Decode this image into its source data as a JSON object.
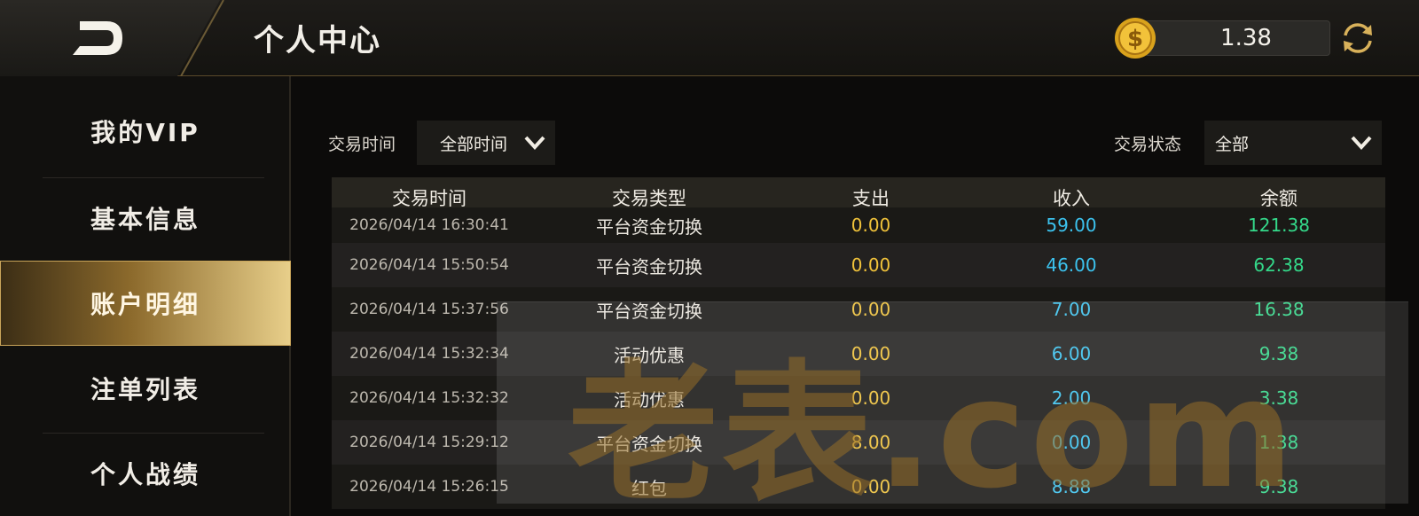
{
  "header": {
    "title": "个人中心",
    "balance": "1.38"
  },
  "sidebar": {
    "items": [
      {
        "label": "我的VIP"
      },
      {
        "label": "基本信息"
      },
      {
        "label": "账户明细"
      },
      {
        "label": "注单列表"
      },
      {
        "label": "个人战绩"
      }
    ]
  },
  "filters": {
    "time_label": "交易时间",
    "time_value": "全部时间",
    "status_label": "交易状态",
    "status_value": "全部"
  },
  "table": {
    "headers": [
      "交易时间",
      "交易类型",
      "支出",
      "收入",
      "余额"
    ],
    "rows": [
      {
        "time": "2026/04/14 16:30:41",
        "type": "平台资金切换",
        "out": "0.00",
        "in": "59.00",
        "balance": "121.38"
      },
      {
        "time": "2026/04/14 15:50:54",
        "type": "平台资金切换",
        "out": "0.00",
        "in": "46.00",
        "balance": "62.38"
      },
      {
        "time": "2026/04/14 15:37:56",
        "type": "平台资金切换",
        "out": "0.00",
        "in": "7.00",
        "balance": "16.38"
      },
      {
        "time": "2026/04/14 15:32:34",
        "type": "活动优惠",
        "out": "0.00",
        "in": "6.00",
        "balance": "9.38"
      },
      {
        "time": "2026/04/14 15:32:32",
        "type": "活动优惠",
        "out": "0.00",
        "in": "2.00",
        "balance": "3.38"
      },
      {
        "time": "2026/04/14 15:29:12",
        "type": "平台资金切换",
        "out": "8.00",
        "in": "0.00",
        "balance": "1.38"
      },
      {
        "time": "2026/04/14 15:26:15",
        "type": "红包",
        "out": "0.00",
        "in": "8.88",
        "balance": "9.38"
      }
    ]
  },
  "watermark": "老表.com",
  "colors": {
    "accent_gold": "#c9a55a",
    "out": "#f0c23a",
    "in": "#3cc3ef",
    "balance": "#34d98a"
  }
}
